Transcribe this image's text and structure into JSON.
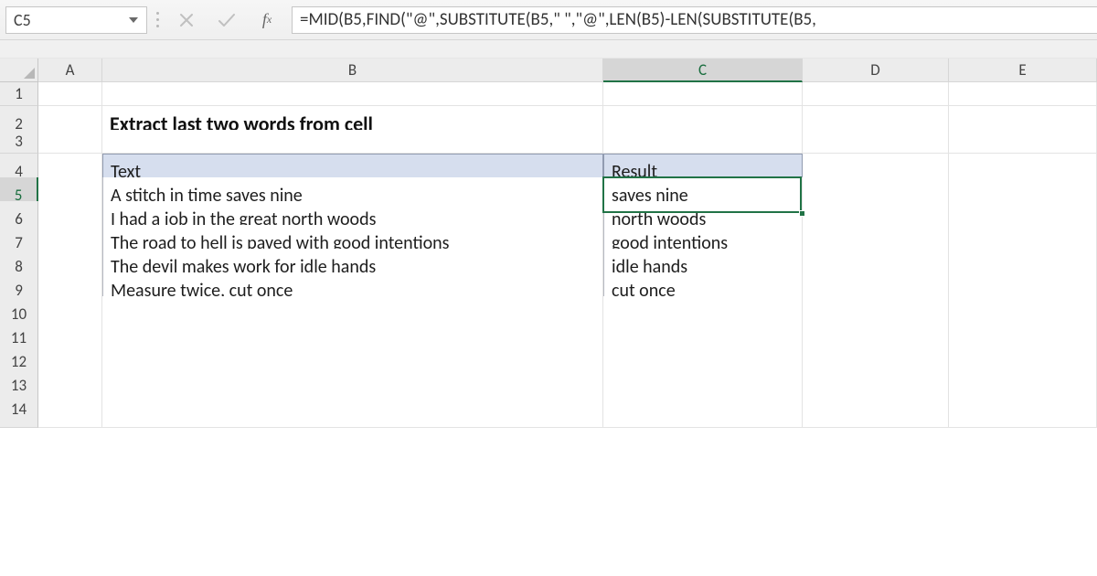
{
  "name_box": {
    "value": "C5"
  },
  "formula_bar": {
    "formula": "=MID(B5,FIND(\"@\",SUBSTITUTE(B5,\" \",\"@\",LEN(B5)-LEN(SUBSTITUTE(B5,"
  },
  "column_headers": [
    "A",
    "B",
    "C",
    "D",
    "E"
  ],
  "row_headers": [
    "1",
    "2",
    "3",
    "4",
    "5",
    "6",
    "7",
    "8",
    "9",
    "10",
    "11",
    "12",
    "13",
    "14"
  ],
  "title": "Extract last two words from cell",
  "table": {
    "headers": {
      "text": "Text",
      "result": "Result"
    },
    "rows": [
      {
        "text": "A stitch in time saves nine",
        "result": "saves nine"
      },
      {
        "text": "I had a job in the great north woods",
        "result": "north woods"
      },
      {
        "text": "The road to hell is paved with good intentions",
        "result": "good intentions"
      },
      {
        "text": "The devil makes work for idle hands",
        "result": "idle hands"
      },
      {
        "text": "Measure twice, cut once",
        "result": "cut once"
      }
    ]
  },
  "active_cell": {
    "col": "C",
    "row": 5
  }
}
